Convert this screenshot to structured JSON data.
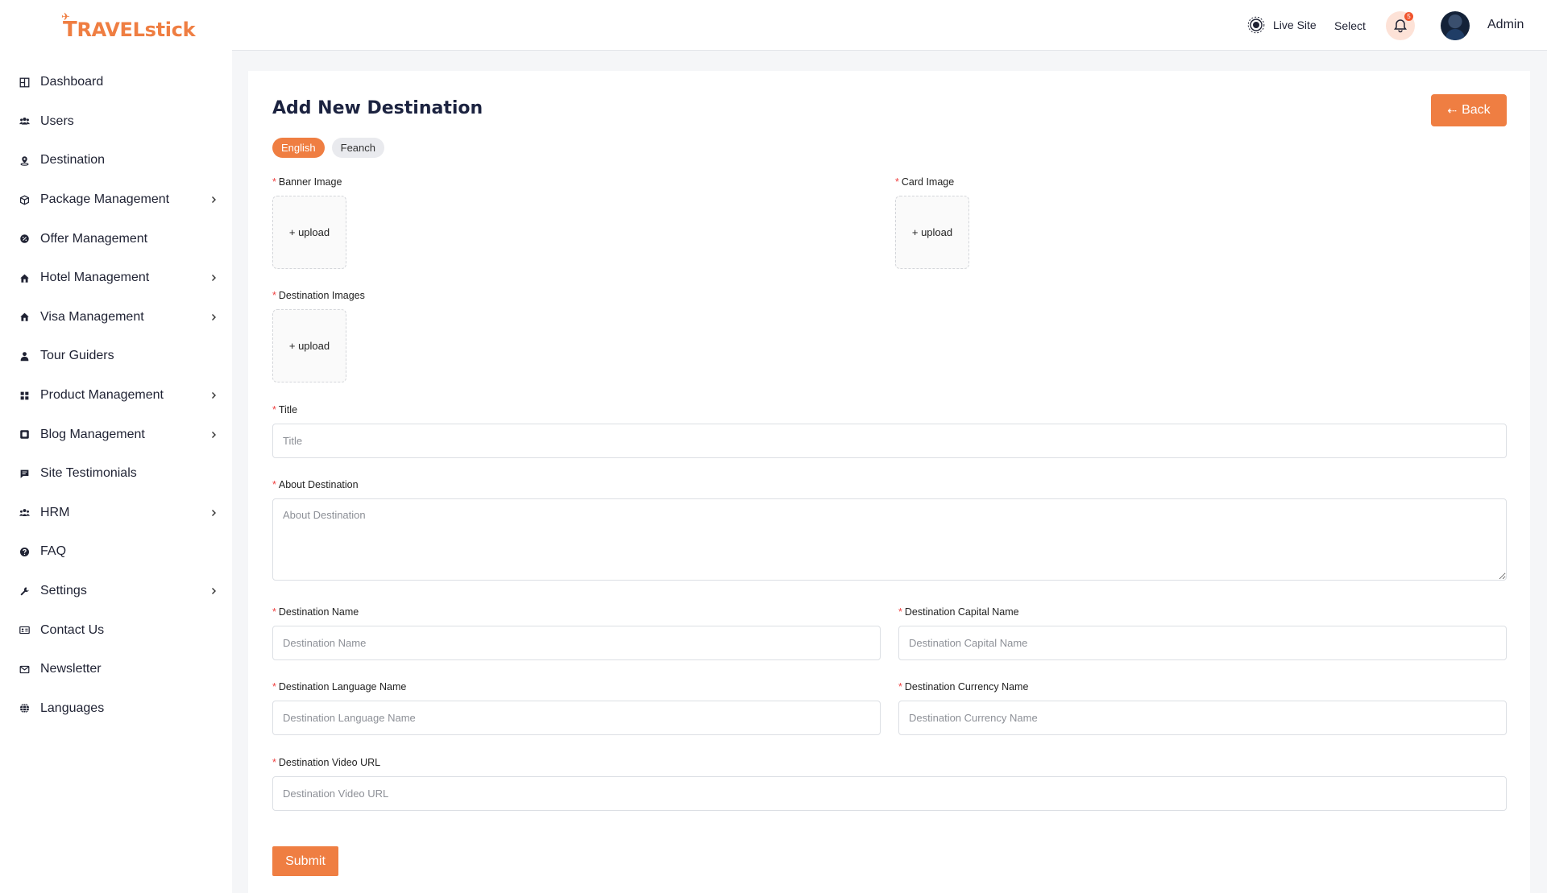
{
  "app": {
    "logo_text_a": "T",
    "logo_text_b": "RAVEL",
    "logo_text_c": "stick",
    "logo_icon": "plane-icon"
  },
  "sidebar": {
    "items": [
      {
        "label": "Dashboard",
        "icon": "dashboard-icon",
        "has_submenu": false
      },
      {
        "label": "Users",
        "icon": "users-icon",
        "has_submenu": false
      },
      {
        "label": "Destination",
        "icon": "location-pin-icon",
        "has_submenu": false
      },
      {
        "label": "Package Management",
        "icon": "package-icon",
        "has_submenu": true
      },
      {
        "label": "Offer Management",
        "icon": "offer-icon",
        "has_submenu": false
      },
      {
        "label": "Hotel Management",
        "icon": "hotel-icon",
        "has_submenu": true
      },
      {
        "label": "Visa Management",
        "icon": "visa-icon",
        "has_submenu": true
      },
      {
        "label": "Tour Guiders",
        "icon": "guide-icon",
        "has_submenu": false
      },
      {
        "label": "Product Management",
        "icon": "grid-icon",
        "has_submenu": true
      },
      {
        "label": "Blog Management",
        "icon": "blog-icon",
        "has_submenu": true
      },
      {
        "label": "Site Testimonials",
        "icon": "comment-icon",
        "has_submenu": false
      },
      {
        "label": "HRM",
        "icon": "team-icon",
        "has_submenu": true
      },
      {
        "label": "FAQ",
        "icon": "question-icon",
        "has_submenu": false
      },
      {
        "label": "Settings",
        "icon": "wrench-icon",
        "has_submenu": true
      },
      {
        "label": "Contact Us",
        "icon": "contact-card-icon",
        "has_submenu": false
      },
      {
        "label": "Newsletter",
        "icon": "envelope-icon",
        "has_submenu": false
      },
      {
        "label": "Languages",
        "icon": "globe-icon",
        "has_submenu": false
      }
    ]
  },
  "topbar": {
    "live_site_label": "Live Site",
    "select_label": "Select",
    "notification_count": "5",
    "user_name": "Admin"
  },
  "page": {
    "title": "Add New Destination",
    "back_label": "Back",
    "lang_tabs": [
      {
        "label": "English",
        "active": true
      },
      {
        "label": "Feanch",
        "active": false
      }
    ],
    "upload_label": "+ upload",
    "required_mark": "*",
    "fields": {
      "banner_image": "Banner Image",
      "card_image": "Card Image",
      "destination_images": "Destination Images",
      "title": {
        "label": "Title",
        "placeholder": "Title",
        "value": ""
      },
      "about": {
        "label": "About Destination",
        "placeholder": "About Destination",
        "value": ""
      },
      "name": {
        "label": "Destination Name",
        "placeholder": "Destination Name",
        "value": ""
      },
      "capital": {
        "label": "Destination Capital Name",
        "placeholder": "Destination Capital Name",
        "value": ""
      },
      "language": {
        "label": "Destination Language Name",
        "placeholder": "Destination Language Name",
        "value": ""
      },
      "currency": {
        "label": "Destination Currency Name",
        "placeholder": "Destination Currency Name",
        "value": ""
      },
      "video_url": {
        "label": "Destination Video URL",
        "placeholder": "Destination Video URL",
        "value": ""
      }
    },
    "submit_label": "Submit"
  },
  "colors": {
    "accent": "#ef7e42",
    "required": "#ef4040",
    "sidebar_bg": "#ffffff",
    "page_bg": "#f5f6f8"
  }
}
